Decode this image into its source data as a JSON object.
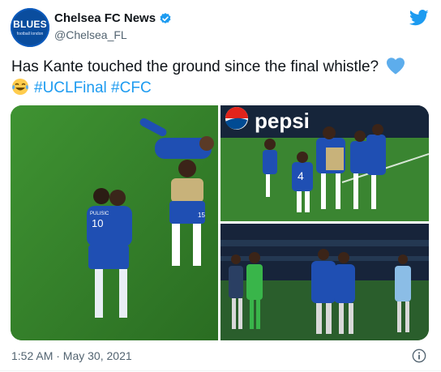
{
  "user": {
    "avatar_text": "BLUES",
    "avatar_small": "football london",
    "display_name": "Chelsea FC News",
    "handle": "@Chelsea_FL"
  },
  "tweet": {
    "text_main": "Has Kante touched the ground since the final whistle?",
    "hashtags": [
      "#UCLFinal",
      "#CFC"
    ],
    "emojis": [
      "blue-heart-icon",
      "tears-of-joy-icon"
    ]
  },
  "media": {
    "photos": [
      {
        "label": "PULISIC",
        "number": "10"
      },
      {
        "label": "pepsi",
        "number": "4"
      },
      {
        "label": "",
        "number": ""
      }
    ]
  },
  "footer": {
    "timestamp": "1:52 AM · May 30, 2021"
  },
  "colors": {
    "accent": "#1d9bf0",
    "chelsea_blue": "#1f4fb3"
  }
}
